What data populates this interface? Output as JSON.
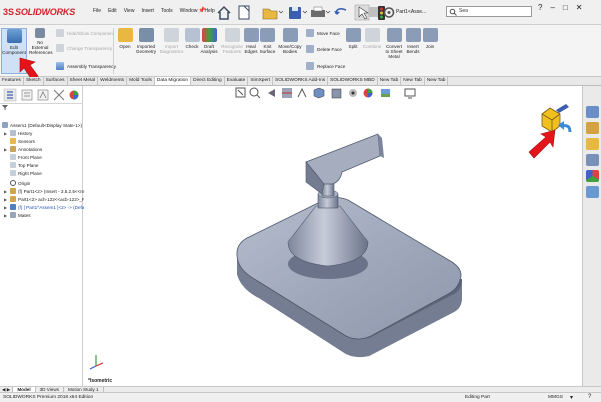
{
  "app": {
    "brand_ds": "3S",
    "brand_name": "SOLIDWORKS"
  },
  "menu": [
    "File",
    "Edit",
    "View",
    "Insert",
    "Tools",
    "Window",
    "Help"
  ],
  "title_bar": {
    "document_title": "Part1<Asse...",
    "search_placeholder": "Sea"
  },
  "ribbon": {
    "edit_component": "Edit\nComponent",
    "no_external_refs": "No\nExternal\nReferences",
    "hide_show_component": "Hide/Show Component",
    "change_transparency": "Change Transparency",
    "assembly_transparency": "Assembly Transparency",
    "open": "Open",
    "imported_geometry": "Imported\nGeometry",
    "import_diagnostics": "Import\nDiagnostics",
    "check": "Check",
    "draft_analysis": "Draft\nAnalysis",
    "recognize_features": "Recognize\nFeatures",
    "heal_edges": "Heal\nEdges",
    "knit_surface": "Knit\nSurface",
    "move_copy_bodies": "Move/Copy\nBodies",
    "move_face": "Move Face",
    "delete_face": "Delete Face",
    "replace_face": "Replace Face",
    "split": "Split",
    "combine": "Combine",
    "convert_sheet_metal": "Convert\nto Sheet\nMetal",
    "insert_bends": "Insert\nBends",
    "join": "Join"
  },
  "tabs": [
    "Features",
    "Sketch",
    "Surfaces",
    "Sheet Metal",
    "Weldments",
    "Mold Tools",
    "Data Migration",
    "Direct Editing",
    "Evaluate",
    "SimXpert",
    "SOLIDWORKS Add-Ins",
    "SOLIDWORKS MBD",
    "New Tab",
    "New Tab",
    "New Tab"
  ],
  "active_tab": "Data Migration",
  "tree": {
    "root": "Assem1  (Default<Display State-1>)",
    "items": [
      "History",
      "Sensors",
      "Annotations",
      "Front Plane",
      "Top Plane",
      "Right Plane",
      "Origin",
      "(f) Part1<2> (Insert - 3.5.2.5<<Insi",
      "Part1<2> ach-122<<acb-122>_Pi",
      "(f) [ Part1^Assem1 ]<2> -> (Defau",
      "Mates"
    ]
  },
  "viewport": {
    "orientation_label": "*Isometric"
  },
  "bottom_tabs": [
    "Model",
    "3D Views",
    "Motion Study 1"
  ],
  "active_bottom_tab": "Model",
  "status": {
    "edition": "SOLIDWORKS Premium 2018 x64 Edition",
    "editing": "Editing Part",
    "units": "MMGS"
  },
  "colors": {
    "brand": "#d3202a",
    "arrow": "#e3151b",
    "ribbon_bg": "#f4f4f4",
    "part_fill": "#9aa3b8"
  }
}
